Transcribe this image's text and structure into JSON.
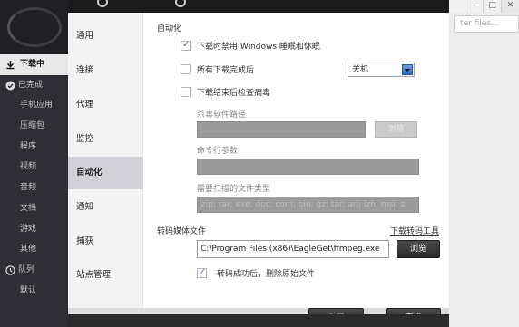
{
  "app": {
    "search_placeholder": "ter files...",
    "window_controls": [
      "–",
      "□",
      "✕"
    ],
    "nav": [
      {
        "label": "下载中",
        "icon": "download-icon",
        "active": true
      },
      {
        "label": "已完成",
        "icon": "check-circle-icon"
      },
      {
        "label": "手机应用"
      },
      {
        "label": "压缩包"
      },
      {
        "label": "程序"
      },
      {
        "label": "视频"
      },
      {
        "label": "音频"
      },
      {
        "label": "文档"
      },
      {
        "label": "游戏"
      },
      {
        "label": "其他"
      },
      {
        "label": "队列",
        "icon": "clock-icon"
      },
      {
        "label": "默认"
      }
    ]
  },
  "dialog": {
    "nav": [
      {
        "label": "通用"
      },
      {
        "label": "连接"
      },
      {
        "label": "代理"
      },
      {
        "label": "监控"
      },
      {
        "label": "自动化",
        "active": true
      },
      {
        "label": "通知"
      },
      {
        "label": "捕获"
      },
      {
        "label": "站点管理"
      }
    ],
    "section_title": "自动化",
    "options": {
      "disable_sleep": {
        "label": "下载时禁用 Windows 睡眠和休眠",
        "checked": true
      },
      "all_complete": {
        "label": "所有下载完成后",
        "checked": false,
        "select_value": "关机"
      },
      "virus_check": {
        "label": "下载结束后检查病毒",
        "checked": false
      }
    },
    "antivirus": {
      "path_label": "杀毒软件路径",
      "browse_label": "浏览",
      "args_label": "命令行参数",
      "types_label": "需要扫描的文件类型",
      "types_value": "zip; rar; exe; doc; com; bin; gz; tar; arj; lzh; msi; z"
    },
    "transcode": {
      "label": "转码媒体文件",
      "download_link": "下载转码工具",
      "path_value": "C:\\Program Files (x86)\\EagleGet\\ffmpeg.exe",
      "browse_label": "浏览",
      "delete_original": {
        "label": "转码成功后，删除原始文件",
        "checked": true
      }
    },
    "footer": {
      "reset_label": "重置",
      "finish_label": "完成"
    }
  }
}
